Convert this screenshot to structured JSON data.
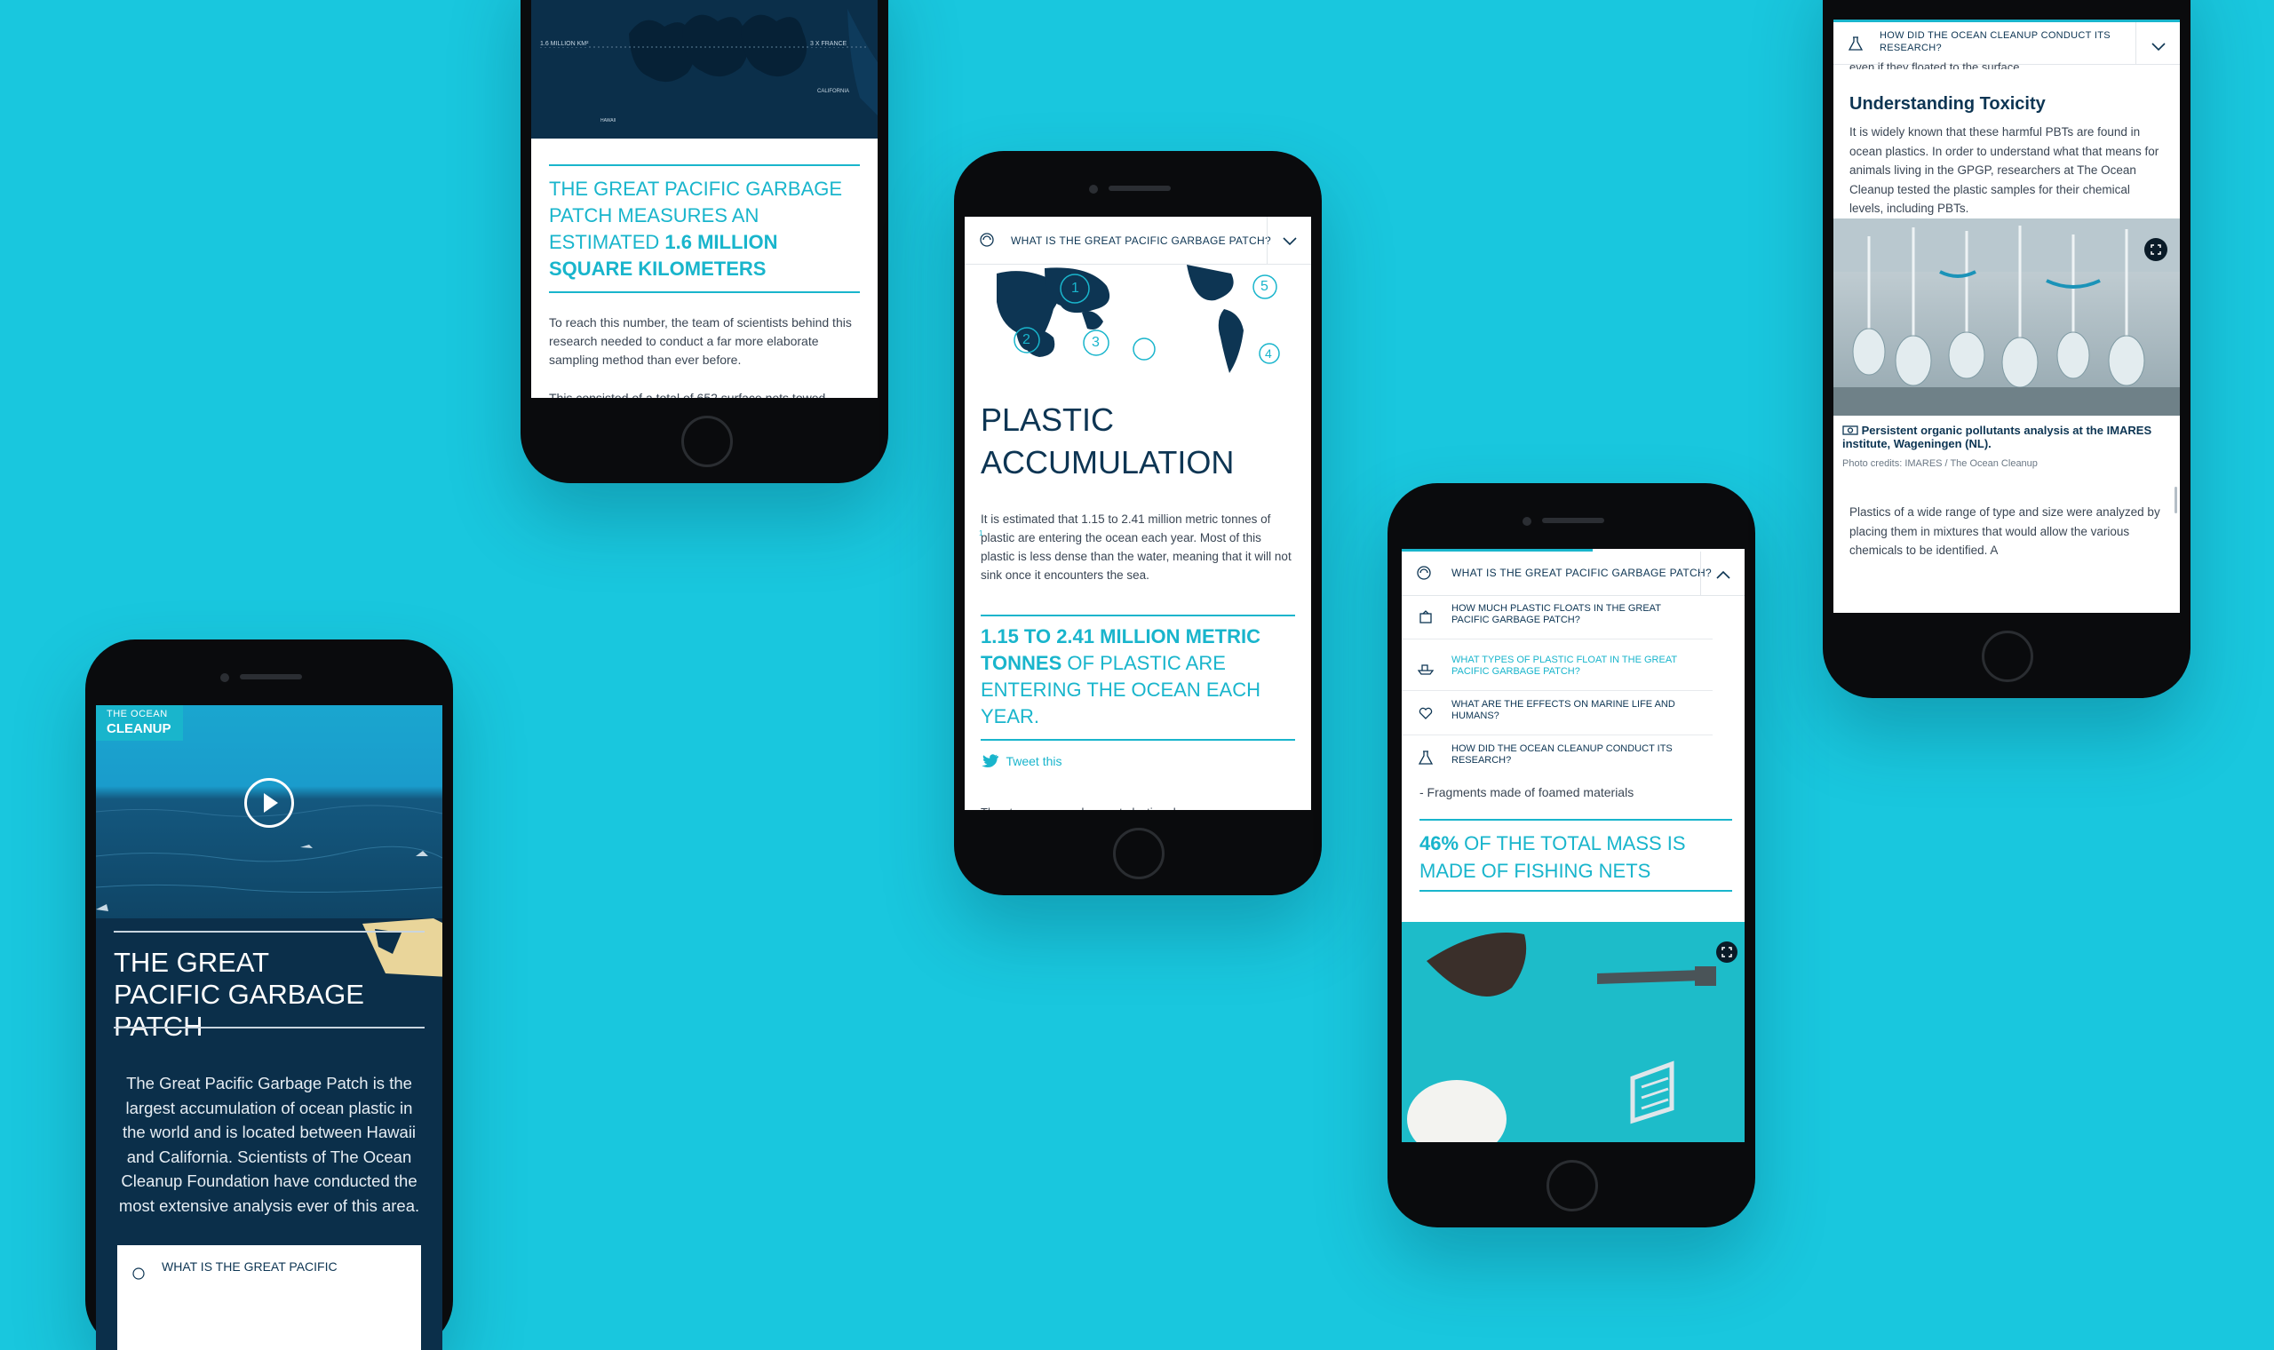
{
  "colors": {
    "background": "#19c7de",
    "accent": "#19b5cc",
    "navy": "#0d3553",
    "ocean_dark": "#0b2f4a"
  },
  "phone_top_left": {
    "map_labels": [
      "1.6 MILLION KM²",
      "3 X FRANCE",
      "CALIFORNIA",
      "HAWAII"
    ],
    "headline_part1": "THE GREAT PACIFIC GARBAGE PATCH MEASURES AN ESTIMATED",
    "headline_bold": "1.6 MILLION SQUARE KILOMETERS",
    "paragraph": "To reach this number, the team of scientists behind this research needed to conduct a far more elaborate sampling method than ever before.",
    "paragraph_cut": "This consisted of a total of 652 surface nets towed"
  },
  "phone_center": {
    "nav_icon": "gyre-icon",
    "nav_title": "WHAT IS THE GREAT PACIFIC GARBAGE PATCH?",
    "gyre_numbers": [
      "1",
      "2",
      "3",
      "4",
      "5"
    ],
    "heading": "PLASTIC ACCUMULATION",
    "paragraph": "It is estimated that 1.15 to 2.41 million metric tonnes of plastic are entering the ocean each year. Most of this plastic is less dense than the water, meaning that it will not sink once it encounters the sea.",
    "footnote": "1",
    "quote_bold": "1.15 TO 2.41 MILLION METRIC TONNES",
    "quote_rest": "OF PLASTIC ARE ENTERING THE OCEAN EACH YEAR.",
    "tweet_label": "Tweet this",
    "next_line_cut": "The stronger, more buoyant plastics show"
  },
  "phone_bottom_left": {
    "logo_line1": "THE OCEAN",
    "logo_line2": "CLEANUP",
    "title": "THE GREAT PACIFIC GARBAGE PATCH",
    "intro": "The Great Pacific Garbage Patch is the largest accumulation of ocean plastic in the world and is located between Hawaii and California. Scientists of The Ocean Cleanup Foundation have conducted the most extensive analysis ever of this area.",
    "bottom_nav_title": "WHAT IS THE GREAT PACIFIC"
  },
  "phone_bottom_right": {
    "nav_title": "WHAT IS THE GREAT PACIFIC GARBAGE PATCH?",
    "menu": [
      {
        "icon": "buoy-icon",
        "label": "HOW MUCH PLASTIC FLOATS IN THE GREAT PACIFIC GARBAGE PATCH?",
        "active": false
      },
      {
        "icon": "boat-icon",
        "label": "WHAT TYPES OF PLASTIC FLOAT IN THE GREAT PACIFIC GARBAGE PATCH?",
        "active": true
      },
      {
        "icon": "heart-icon",
        "label": "WHAT ARE THE EFFECTS ON MARINE LIFE AND HUMANS?",
        "active": false
      },
      {
        "icon": "flask-icon",
        "label": "HOW DID THE OCEAN CLEANUP CONDUCT ITS RESEARCH?",
        "active": false
      }
    ],
    "list_item": "- Fragments made of foamed materials",
    "stat_bold": "46%",
    "stat_rest": "OF THE TOTAL MASS IS MADE OF FISHING NETS"
  },
  "phone_top_right": {
    "nav_title": "HOW DID THE OCEAN CLEANUP CONDUCT ITS RESEARCH?",
    "cut_line": "even if they floated to the surface.",
    "heading": "Understanding Toxicity",
    "paragraph": "It is widely known that these harmful PBTs are found in ocean plastics. In order to understand what that means for animals living in the GPGP, researchers at The Ocean Cleanup tested the plastic samples for their chemical levels, including PBTs.",
    "caption": "Persistent organic pollutants analysis at the IMARES institute, Wageningen (NL).",
    "credits": "Photo credits: IMARES / The Ocean Cleanup",
    "paragraph2": "Plastics of a wide range of type and size were analyzed by placing them in mixtures that would allow the various chemicals to be identified. A"
  }
}
